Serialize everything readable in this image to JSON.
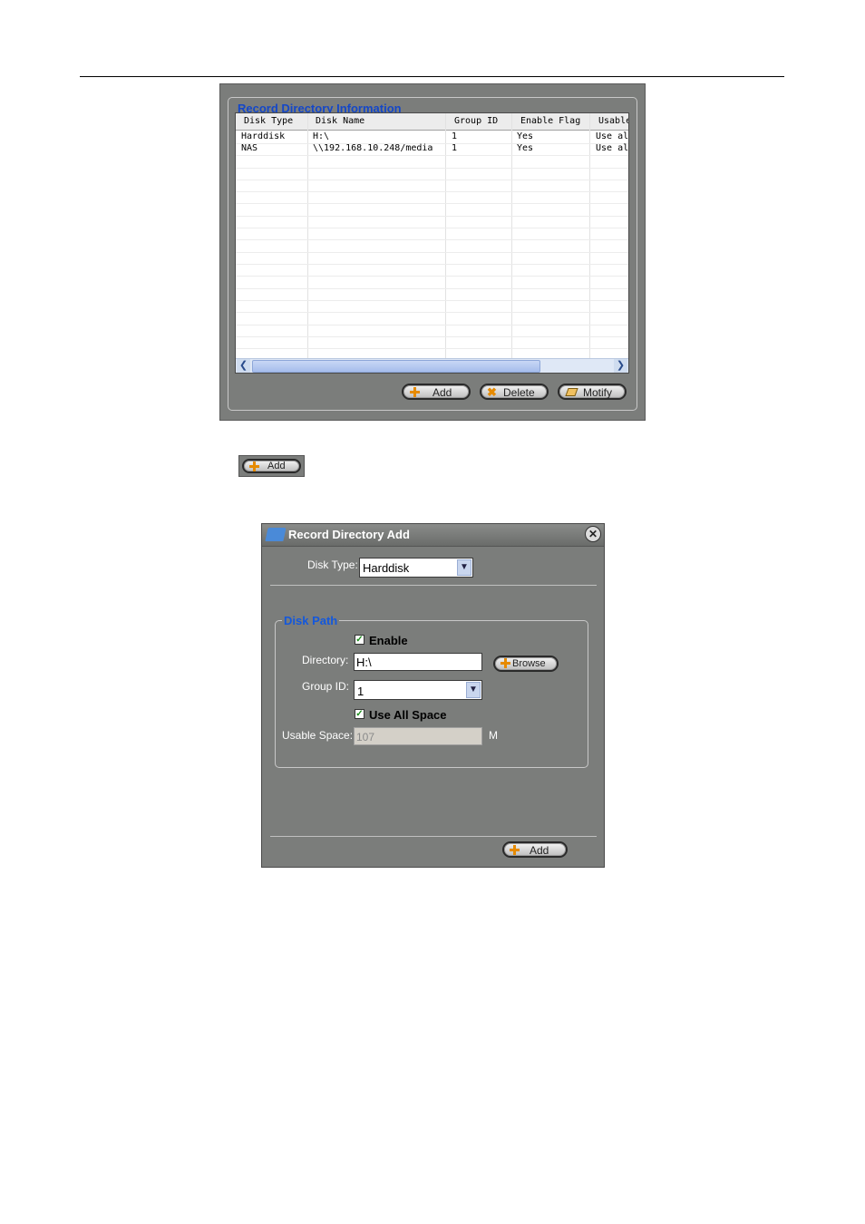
{
  "panel1": {
    "legend": "Record Directory Information",
    "columns": [
      "Disk Type",
      "Disk Name",
      "Group ID",
      "Enable Flag",
      "Usable"
    ],
    "rows": [
      [
        "Harddisk",
        "H:\\",
        "1",
        "Yes",
        "Use al"
      ],
      [
        "NAS",
        "\\\\192.168.10.248/media",
        "1",
        "Yes",
        "Use al"
      ]
    ],
    "buttons": {
      "add": "Add",
      "delete": "Delete",
      "modify": "Motify"
    }
  },
  "standalone_button": {
    "add": "Add"
  },
  "dialog": {
    "title": "Record Directory Add",
    "disk_type_label": "Disk Type:",
    "disk_type_value": "Harddisk",
    "group_legend": "Disk Path",
    "enable_label": "Enable",
    "directory_label": "Directory:",
    "directory_value": "H:\\",
    "browse_label": "Browse",
    "group_id_label": "Group ID:",
    "group_id_value": "1",
    "use_all_space_label": "Use All Space",
    "usable_space_label": "Usable Space:",
    "usable_space_value": "107",
    "usable_space_unit": "M",
    "add_button": "Add"
  },
  "colors": {
    "panel_bg": "#7b7d7b",
    "legend_blue": "#1447c8",
    "icon_orange": "#e68a00"
  },
  "icons": [
    "plus-icon",
    "delete-x-icon",
    "pencil-icon",
    "folder-icon",
    "close-icon",
    "dropdown-arrow-icon",
    "checkbox-check-icon"
  ]
}
